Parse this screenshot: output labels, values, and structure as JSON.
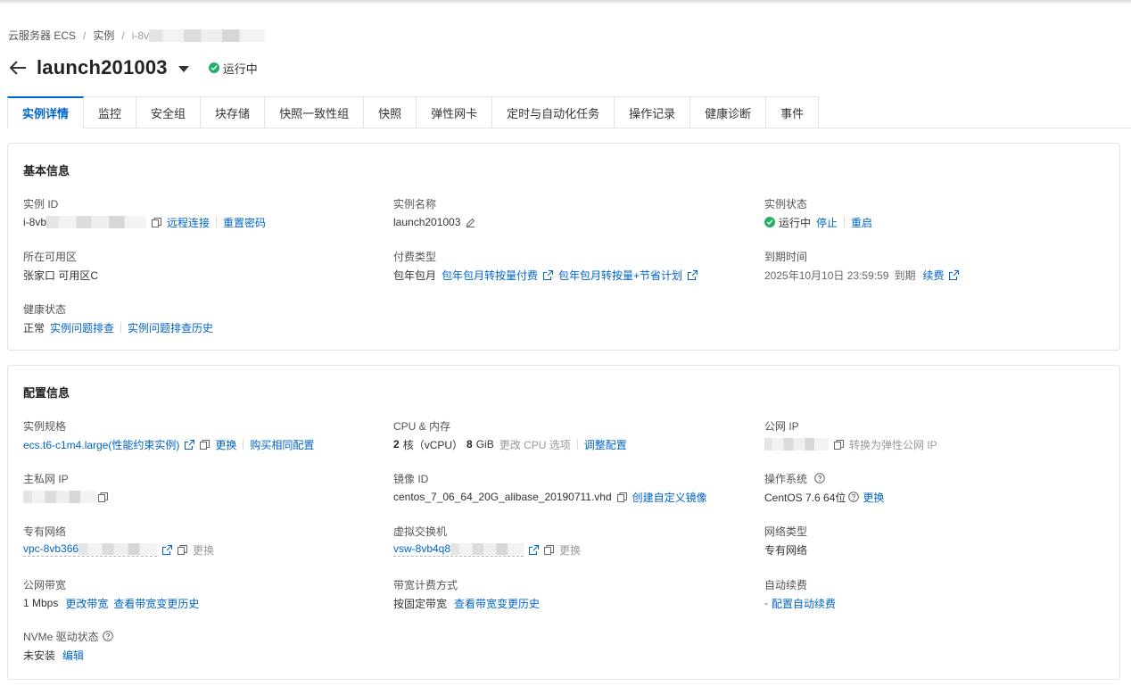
{
  "breadcrumb": {
    "items": [
      "云服务器 ECS",
      "实例",
      "i-8v"
    ]
  },
  "header": {
    "title": "launch201003",
    "status": "运行中"
  },
  "tabs": [
    "实例详情",
    "监控",
    "安全组",
    "块存储",
    "快照一致性组",
    "快照",
    "弹性网卡",
    "定时与自动化任务",
    "操作记录",
    "健康诊断",
    "事件"
  ],
  "basic": {
    "section_title": "基本信息",
    "instance_id_label": "实例 ID",
    "instance_id_prefix": "i-8vb",
    "remote_connect": "远程连接",
    "reset_password": "重置密码",
    "instance_name_label": "实例名称",
    "instance_name": "launch201003",
    "instance_status_label": "实例状态",
    "instance_status": "运行中",
    "stop": "停止",
    "restart": "重启",
    "zone_label": "所在可用区",
    "zone": "张家口 可用区C",
    "billing_label": "付费类型",
    "billing": "包年包月",
    "billing_link1": "包年包月转按量付费",
    "billing_link2": "包年包月转按量+节省计划",
    "expire_label": "到期时间",
    "expire_time": "2025年10月10日 23:59:59",
    "expire_suffix": "到期",
    "renew": "续费",
    "health_label": "健康状态",
    "health": "正常",
    "troubleshoot": "实例问题排查",
    "troubleshoot_history": "实例问题排查历史"
  },
  "config": {
    "section_title": "配置信息",
    "spec_label": "实例规格",
    "spec": "ecs.t6-c1m4.large(性能约束实例)",
    "change": "更换",
    "buy_same": "购买相同配置",
    "cpu_label": "CPU & 内存",
    "cpu_count": "2",
    "cpu_unit": "核（vCPU）",
    "memory": "8",
    "memory_unit": "GiB",
    "change_cpu_option": "更改 CPU 选项",
    "adjust_config": "调整配置",
    "public_ip_label": "公网 IP",
    "convert_eip": "转换为弹性公网 IP",
    "private_ip_label": "主私网 IP",
    "image_label": "镜像 ID",
    "image_id": "centos_7_06_64_20G_alibase_20190711.vhd",
    "create_image": "创建自定义镜像",
    "os_label": "操作系统",
    "os": "CentOS 7.6 64位",
    "os_change": "更换",
    "vpc_label": "专有网络",
    "vpc_prefix": "vpc-8vb366",
    "vpc_change": "更换",
    "vswitch_label": "虚拟交换机",
    "vswitch_prefix": "vsw-8vb4q8",
    "vswitch_change": "更换",
    "network_type_label": "网络类型",
    "network_type": "专有网络",
    "bandwidth_label": "公网带宽",
    "bandwidth": "1 Mbps",
    "change_bandwidth": "更改带宽",
    "bandwidth_history": "查看带宽变更历史",
    "bw_billing_label": "带宽计费方式",
    "bw_billing": "按固定带宽",
    "bw_billing_history": "查看带宽变更历史",
    "auto_renew_label": "自动续费",
    "auto_renew_value": "-",
    "auto_renew_link": "配置自动续费",
    "nvme_label": "NVMe 驱动状态",
    "nvme": "未安装",
    "nvme_edit": "编辑"
  },
  "colors": {
    "link": "#0064c8",
    "success": "#23b066",
    "border": "#e3e3e3"
  },
  "icons": [
    "back-arrow-icon",
    "caret-down-icon",
    "check-circle-icon",
    "copy-icon",
    "edit-icon",
    "external-link-icon",
    "help-icon"
  ]
}
